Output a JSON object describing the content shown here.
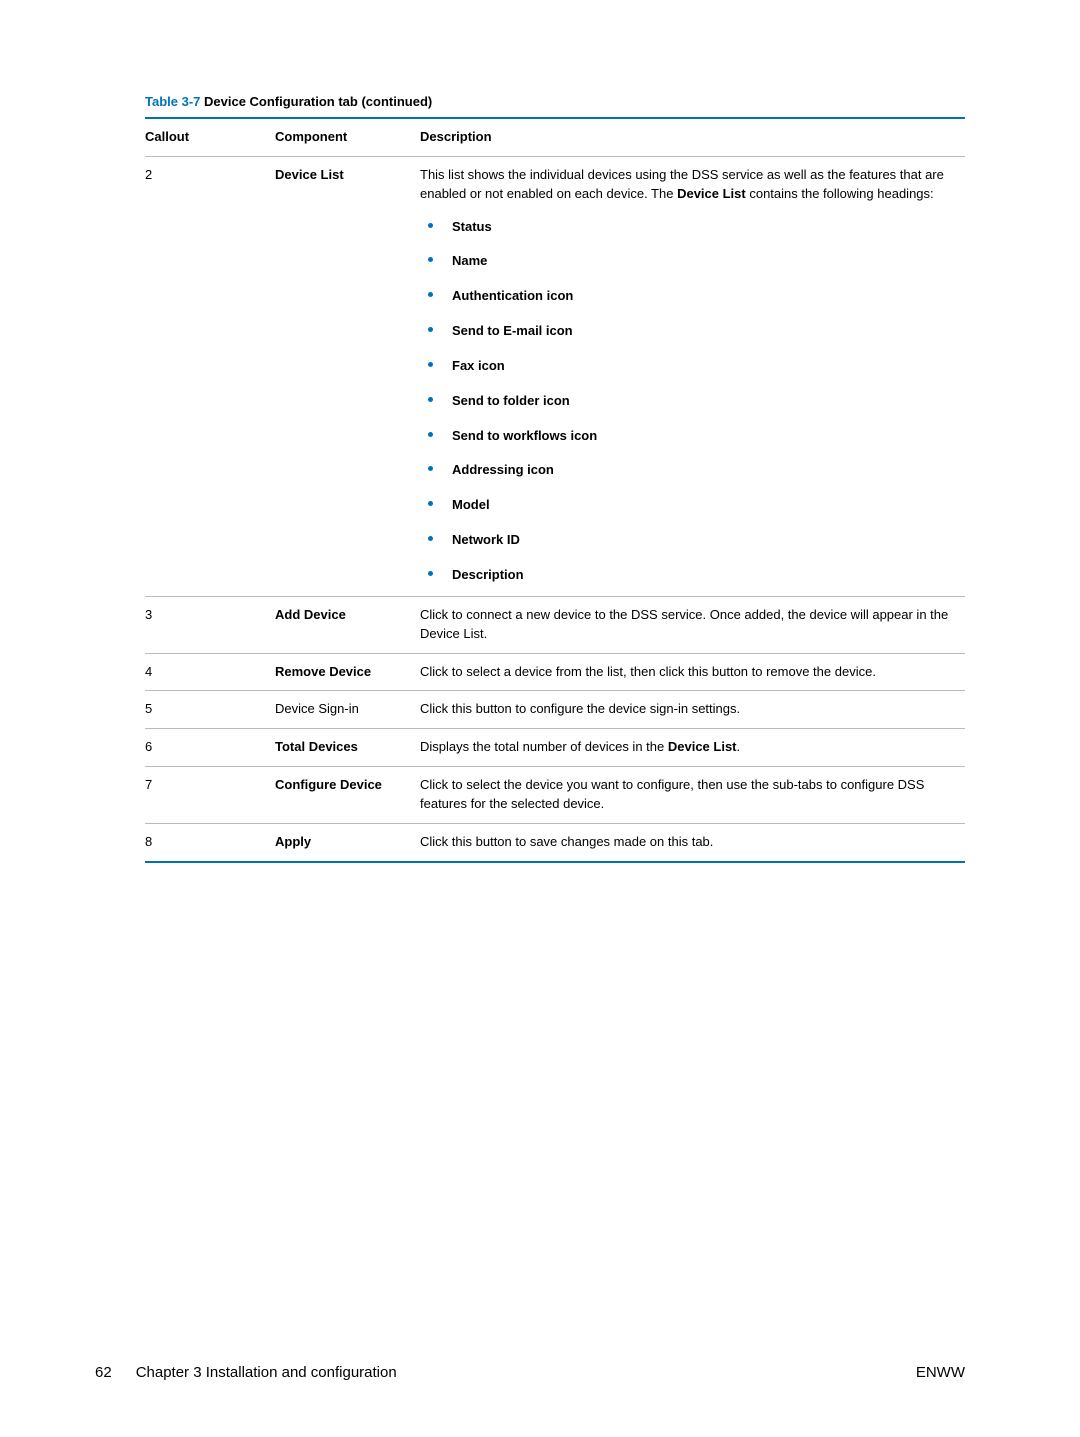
{
  "caption": {
    "label": "Table 3-7",
    "title": "  Device Configuration tab (continued)"
  },
  "headers": {
    "callout": "Callout",
    "component": "Component",
    "description": "Description"
  },
  "rows": {
    "r2": {
      "callout": "2",
      "component": "Device List",
      "component_bold": true,
      "desc_pre": "This list shows the individual devices using the DSS service as well as the features that are enabled or not enabled on each device. The ",
      "desc_bold": "Device List",
      "desc_post": " contains the following headings:",
      "bullets": [
        "Status",
        "Name",
        "Authentication icon",
        "Send to E-mail icon",
        "Fax icon",
        "Send to folder icon",
        "Send to workflows icon",
        "Addressing icon",
        "Model",
        "Network ID",
        "Description"
      ]
    },
    "r3": {
      "callout": "3",
      "component": "Add Device",
      "component_bold": true,
      "desc": "Click to connect a new device to the DSS service. Once added, the device will appear in the Device List."
    },
    "r4": {
      "callout": "4",
      "component": "Remove Device",
      "component_bold": true,
      "desc": "Click to select a device from the list, then click this button to remove the device."
    },
    "r5": {
      "callout": "5",
      "component": "Device Sign-in",
      "component_bold": false,
      "desc": "Click this button to configure the device sign-in settings."
    },
    "r6": {
      "callout": "6",
      "component": "Total Devices",
      "component_bold": true,
      "desc_pre": "Displays the total number of devices in the ",
      "desc_bold": "Device List",
      "desc_post": "."
    },
    "r7": {
      "callout": "7",
      "component": "Configure Device",
      "component_bold": true,
      "desc": "Click to select the device you want to configure, then use the sub-tabs to configure DSS features for the selected device."
    },
    "r8": {
      "callout": "8",
      "component": "Apply",
      "component_bold": true,
      "desc": "Click this button to save changes made on this tab."
    }
  },
  "footer": {
    "page": "62",
    "chapter": "Chapter 3   Installation and configuration",
    "right": "ENWW"
  }
}
